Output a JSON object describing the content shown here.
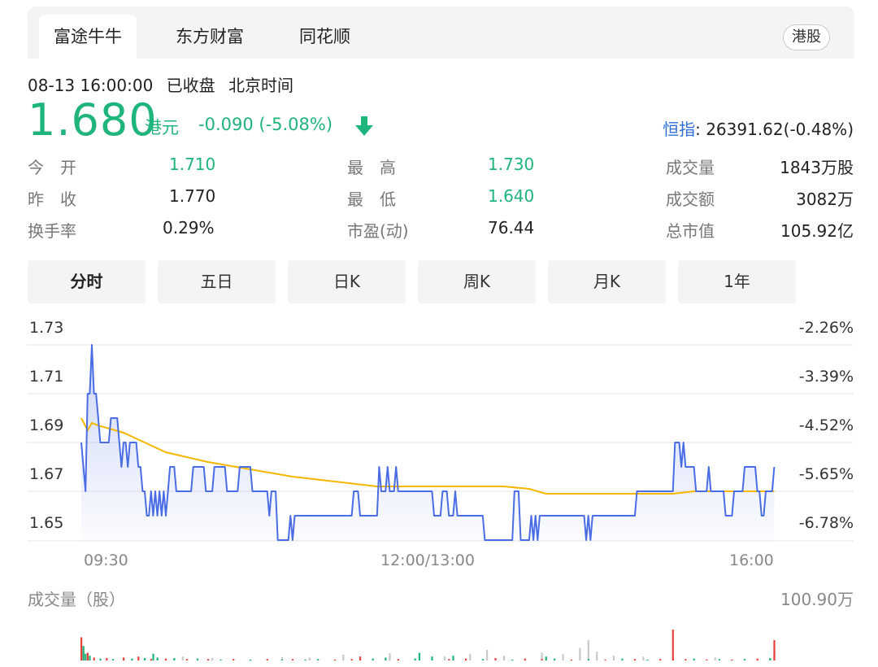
{
  "tabs": [
    {
      "label": "富途牛牛",
      "active": true
    },
    {
      "label": "东方财富",
      "active": false
    },
    {
      "label": "同花顺",
      "active": false
    }
  ],
  "market_badge": "港股",
  "status": {
    "datetime": "08-13 16:00:00",
    "state": "已收盘",
    "timezone": "北京时间"
  },
  "quote": {
    "price": "1.680",
    "unit": "港元",
    "change": "-0.090 (-5.08%)",
    "direction": "down"
  },
  "index": {
    "name": "恒指",
    "value": ": 26391.62(-0.48%)"
  },
  "stats": [
    {
      "label": "今　开",
      "value": "1.710",
      "color": "green"
    },
    {
      "label": "最　高",
      "value": "1.730",
      "color": "green"
    },
    {
      "label": "成交量",
      "value": "1843万股",
      "color": "plain"
    },
    {
      "label": "昨　收",
      "value": "1.770",
      "color": "plain"
    },
    {
      "label": "最　低",
      "value": "1.640",
      "color": "green"
    },
    {
      "label": "成交额",
      "value": "3082万",
      "color": "plain"
    },
    {
      "label": "换手率",
      "value": "0.29%",
      "color": "plain"
    },
    {
      "label": "市盈(动)",
      "value": "76.44",
      "color": "plain"
    },
    {
      "label": "总市值",
      "value": "105.92亿",
      "color": "plain"
    }
  ],
  "period_tabs": [
    {
      "label": "分时",
      "active": true
    },
    {
      "label": "五日",
      "active": false
    },
    {
      "label": "日K",
      "active": false
    },
    {
      "label": "周K",
      "active": false
    },
    {
      "label": "月K",
      "active": false
    },
    {
      "label": "1年",
      "active": false
    }
  ],
  "colors": {
    "up": "#e8413c",
    "down": "#1fb47c",
    "price_line": "#4a6de5",
    "avg_line": "#f5b700",
    "grid": "#e6e6e6",
    "index_link": "#2d6fd6"
  },
  "chart_data": {
    "type": "line",
    "y_ticks": [
      "1.73",
      "1.71",
      "1.69",
      "1.67",
      "1.65"
    ],
    "y_ticks_right": [
      "-2.26%",
      "-3.39%",
      "-4.52%",
      "-5.65%",
      "-6.78%"
    ],
    "x_ticks": [
      "09:30",
      "12:00/13:00",
      "16:00"
    ],
    "ylim": [
      1.64,
      1.735
    ],
    "n_points": 330,
    "series": [
      {
        "role": "price",
        "values": [
          [
            0,
            1.69
          ],
          [
            1,
            1.68
          ],
          [
            2,
            1.67
          ],
          [
            3,
            1.71
          ],
          [
            4,
            1.71
          ],
          [
            5,
            1.73
          ],
          [
            6,
            1.71
          ],
          [
            7,
            1.71
          ],
          [
            8,
            1.7
          ],
          [
            9,
            1.69
          ],
          [
            13,
            1.69
          ],
          [
            14,
            1.7
          ],
          [
            17,
            1.7
          ],
          [
            18,
            1.69
          ],
          [
            19,
            1.68
          ],
          [
            20,
            1.69
          ],
          [
            21,
            1.69
          ],
          [
            22,
            1.68
          ],
          [
            23,
            1.69
          ],
          [
            26,
            1.69
          ],
          [
            27,
            1.68
          ],
          [
            28,
            1.68
          ],
          [
            29,
            1.67
          ],
          [
            30,
            1.67
          ],
          [
            31,
            1.66
          ],
          [
            32,
            1.66
          ],
          [
            33,
            1.67
          ],
          [
            34,
            1.66
          ],
          [
            35,
            1.67
          ],
          [
            36,
            1.66
          ],
          [
            37,
            1.67
          ],
          [
            38,
            1.66
          ],
          [
            39,
            1.67
          ],
          [
            40,
            1.66
          ],
          [
            41,
            1.67
          ],
          [
            42,
            1.68
          ],
          [
            44,
            1.68
          ],
          [
            45,
            1.67
          ],
          [
            52,
            1.67
          ],
          [
            53,
            1.68
          ],
          [
            58,
            1.68
          ],
          [
            59,
            1.67
          ],
          [
            62,
            1.67
          ],
          [
            63,
            1.68
          ],
          [
            68,
            1.68
          ],
          [
            69,
            1.67
          ],
          [
            74,
            1.67
          ],
          [
            75,
            1.68
          ],
          [
            80,
            1.68
          ],
          [
            81,
            1.67
          ],
          [
            88,
            1.67
          ],
          [
            89,
            1.66
          ],
          [
            90,
            1.67
          ],
          [
            92,
            1.67
          ],
          [
            93,
            1.65
          ],
          [
            98,
            1.65
          ],
          [
            99,
            1.66
          ],
          [
            100,
            1.65
          ],
          [
            101,
            1.66
          ],
          [
            128,
            1.66
          ],
          [
            129,
            1.67
          ],
          [
            131,
            1.67
          ],
          [
            132,
            1.66
          ],
          [
            140,
            1.66
          ],
          [
            141,
            1.68
          ],
          [
            142,
            1.67
          ],
          [
            144,
            1.67
          ],
          [
            145,
            1.68
          ],
          [
            146,
            1.67
          ],
          [
            148,
            1.67
          ],
          [
            149,
            1.68
          ],
          [
            150,
            1.67
          ],
          [
            166,
            1.67
          ],
          [
            167,
            1.66
          ],
          [
            170,
            1.66
          ],
          [
            171,
            1.67
          ],
          [
            173,
            1.67
          ],
          [
            174,
            1.66
          ],
          [
            176,
            1.66
          ],
          [
            177,
            1.67
          ],
          [
            178,
            1.66
          ],
          [
            190,
            1.66
          ],
          [
            191,
            1.65
          ],
          [
            204,
            1.65
          ],
          [
            205,
            1.67
          ],
          [
            207,
            1.67
          ],
          [
            208,
            1.65
          ],
          [
            212,
            1.65
          ],
          [
            213,
            1.66
          ],
          [
            214,
            1.65
          ],
          [
            215,
            1.66
          ],
          [
            216,
            1.65
          ],
          [
            217,
            1.66
          ],
          [
            238,
            1.66
          ],
          [
            239,
            1.65
          ],
          [
            240,
            1.66
          ],
          [
            241,
            1.65
          ],
          [
            242,
            1.66
          ],
          [
            262,
            1.66
          ],
          [
            263,
            1.67
          ],
          [
            280,
            1.67
          ],
          [
            281,
            1.69
          ],
          [
            283,
            1.69
          ],
          [
            284,
            1.68
          ],
          [
            285,
            1.69
          ],
          [
            286,
            1.68
          ],
          [
            290,
            1.68
          ],
          [
            291,
            1.67
          ],
          [
            296,
            1.67
          ],
          [
            297,
            1.68
          ],
          [
            298,
            1.67
          ],
          [
            304,
            1.67
          ],
          [
            305,
            1.66
          ],
          [
            308,
            1.66
          ],
          [
            309,
            1.67
          ],
          [
            313,
            1.67
          ],
          [
            314,
            1.68
          ],
          [
            319,
            1.68
          ],
          [
            320,
            1.67
          ],
          [
            321,
            1.67
          ],
          [
            322,
            1.66
          ],
          [
            324,
            1.67
          ],
          [
            327,
            1.67
          ],
          [
            328,
            1.68
          ]
        ]
      },
      {
        "role": "average",
        "values": [
          [
            0,
            1.7
          ],
          [
            3,
            1.695
          ],
          [
            5,
            1.698
          ],
          [
            8,
            1.697
          ],
          [
            12,
            1.696
          ],
          [
            20,
            1.694
          ],
          [
            30,
            1.69
          ],
          [
            40,
            1.686
          ],
          [
            50,
            1.684
          ],
          [
            60,
            1.682
          ],
          [
            80,
            1.679
          ],
          [
            100,
            1.676
          ],
          [
            120,
            1.674
          ],
          [
            140,
            1.672
          ],
          [
            160,
            1.672
          ],
          [
            180,
            1.672
          ],
          [
            200,
            1.672
          ],
          [
            212,
            1.671
          ],
          [
            220,
            1.669
          ],
          [
            250,
            1.669
          ],
          [
            270,
            1.669
          ],
          [
            280,
            1.669
          ],
          [
            290,
            1.67
          ],
          [
            300,
            1.67
          ],
          [
            310,
            1.67
          ],
          [
            328,
            1.67
          ]
        ]
      }
    ],
    "volume": {
      "title": "成交量（股）",
      "max_label": "100.90万",
      "max": 100.9,
      "bars": [
        [
          0,
          30,
          "down"
        ],
        [
          1,
          18,
          "up"
        ],
        [
          2,
          14,
          "down"
        ],
        [
          3,
          16,
          "up"
        ],
        [
          4,
          10,
          "down"
        ],
        [
          6,
          6,
          "up"
        ],
        [
          9,
          4,
          "down"
        ],
        [
          12,
          5,
          "up"
        ],
        [
          15,
          3,
          "down"
        ],
        [
          20,
          6,
          "up"
        ],
        [
          24,
          4,
          "down"
        ],
        [
          27,
          8,
          "up"
        ],
        [
          30,
          5,
          "down"
        ],
        [
          33,
          3,
          "up"
        ],
        [
          36,
          6,
          "down"
        ],
        [
          40,
          4,
          "up"
        ],
        [
          44,
          5,
          "down"
        ],
        [
          50,
          3,
          "up"
        ],
        [
          55,
          4,
          "down"
        ],
        [
          60,
          3,
          "up"
        ],
        [
          66,
          2,
          "down"
        ],
        [
          72,
          3,
          "up"
        ],
        [
          80,
          2,
          "down"
        ],
        [
          88,
          3,
          "up"
        ],
        [
          95,
          2,
          "down"
        ],
        [
          100,
          3,
          "up"
        ],
        [
          106,
          2,
          "down"
        ],
        [
          112,
          3,
          "down"
        ],
        [
          120,
          2,
          "up"
        ],
        [
          128,
          3,
          "up"
        ],
        [
          132,
          8,
          "up"
        ],
        [
          138,
          4,
          "down"
        ],
        [
          144,
          6,
          "down"
        ],
        [
          150,
          3,
          "up"
        ],
        [
          158,
          4,
          "down"
        ],
        [
          166,
          8,
          "down"
        ],
        [
          174,
          3,
          "up"
        ],
        [
          182,
          4,
          "up"
        ],
        [
          190,
          3,
          "down"
        ],
        [
          196,
          5,
          "up"
        ],
        [
          204,
          2,
          "down"
        ],
        [
          210,
          4,
          "up"
        ],
        [
          218,
          3,
          "up"
        ],
        [
          224,
          4,
          "down"
        ],
        [
          232,
          2,
          "up"
        ],
        [
          240,
          3,
          "down"
        ],
        [
          248,
          2,
          "up"
        ],
        [
          256,
          4,
          "down"
        ],
        [
          262,
          3,
          "up"
        ],
        [
          268,
          2,
          "down"
        ],
        [
          274,
          3,
          "up"
        ],
        [
          280,
          2,
          "down"
        ],
        [
          286,
          3,
          "up"
        ],
        [
          290,
          4,
          "down"
        ],
        [
          296,
          2,
          "up"
        ],
        [
          302,
          3,
          "down"
        ],
        [
          308,
          2,
          "up"
        ],
        [
          314,
          3,
          "down"
        ],
        [
          320,
          4,
          "up"
        ],
        [
          326,
          5,
          "down"
        ],
        [
          328,
          14,
          "up"
        ]
      ],
      "neutral_bars": [
        [
          48,
          8
        ],
        [
          62,
          5
        ],
        [
          95,
          7
        ],
        [
          108,
          6
        ],
        [
          124,
          12
        ],
        [
          146,
          15
        ],
        [
          160,
          13
        ],
        [
          172,
          8
        ],
        [
          184,
          14
        ],
        [
          192,
          22
        ],
        [
          200,
          10
        ],
        [
          218,
          16
        ],
        [
          228,
          13
        ],
        [
          236,
          26
        ],
        [
          240,
          42
        ],
        [
          244,
          18
        ],
        [
          252,
          10
        ],
        [
          266,
          8
        ],
        [
          280,
          6
        ],
        [
          300,
          6
        ]
      ],
      "spikes_up": [
        [
          0,
          48
        ],
        [
          280,
          64
        ],
        [
          328,
          42
        ]
      ],
      "spikes_down": [
        [
          1,
          30
        ],
        [
          34,
          14
        ],
        [
          160,
          16
        ],
        [
          176,
          10
        ],
        [
          220,
          8
        ]
      ]
    }
  }
}
